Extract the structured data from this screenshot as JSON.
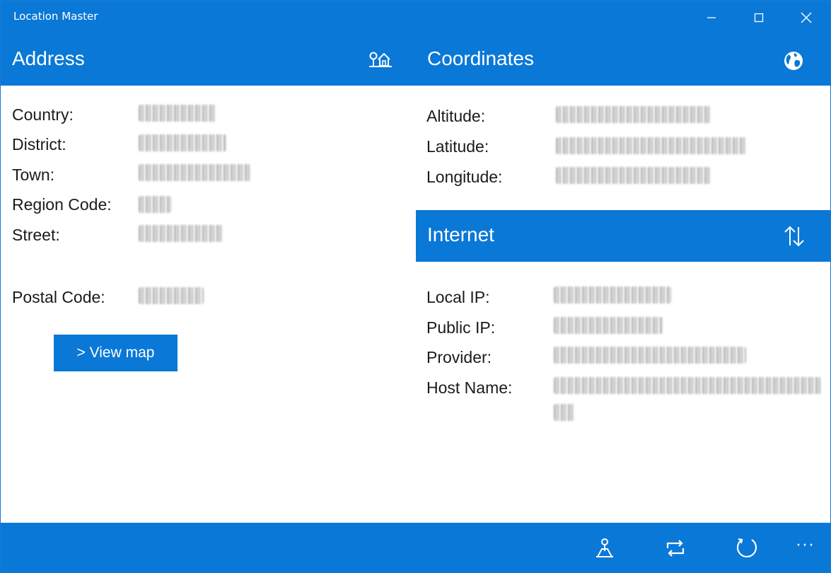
{
  "window": {
    "title": "Location Master",
    "accent": "#0a78d7"
  },
  "address": {
    "title": "Address",
    "icon": "location-home-icon",
    "fields": [
      {
        "label": "Country:",
        "value": "██████"
      },
      {
        "label": "District:",
        "value": "██████"
      },
      {
        "label": "Town:",
        "value": "██████"
      },
      {
        "label": "Region Code:",
        "value": "██"
      },
      {
        "label": "Street:",
        "value": "██████"
      }
    ],
    "postal": {
      "label": "Postal Code:",
      "value": "████"
    },
    "view_map_label": "> View map"
  },
  "coordinates": {
    "title": "Coordinates",
    "icon": "globe-icon",
    "fields": [
      {
        "label": "Altitude:",
        "value": "██████"
      },
      {
        "label": "Latitude:",
        "value": "██████"
      },
      {
        "label": "Longitude:",
        "value": "██████"
      }
    ]
  },
  "internet": {
    "title": "Internet",
    "icon": "up-down-arrows-icon",
    "fields": [
      {
        "label": "Local IP:",
        "value": "██████"
      },
      {
        "label": "Public IP:",
        "value": "██████"
      },
      {
        "label": "Provider:",
        "value": "██████"
      },
      {
        "label": "Host Name:",
        "value": "██████"
      }
    ]
  },
  "appbar": {
    "buttons": [
      "map-pin-icon",
      "repeat-icon",
      "refresh-icon"
    ],
    "more_label": "···"
  }
}
